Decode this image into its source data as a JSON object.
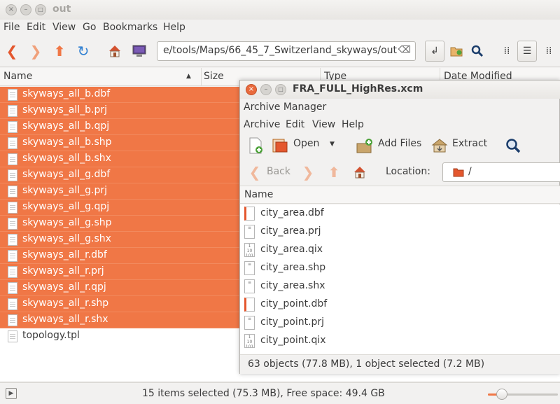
{
  "file_manager": {
    "title": "out",
    "menu": [
      "File",
      "Edit",
      "View",
      "Go",
      "Bookmarks",
      "Help"
    ],
    "location": "e/tools/Maps/66_45_7_Switzerland_skyways/out",
    "columns": {
      "name": "Name",
      "size": "Size",
      "type": "Type",
      "date": "Date Modified"
    },
    "files": [
      "skyways_all_b.dbf",
      "skyways_all_b.prj",
      "skyways_all_b.qpj",
      "skyways_all_b.shp",
      "skyways_all_b.shx",
      "skyways_all_g.dbf",
      "skyways_all_g.prj",
      "skyways_all_g.qpj",
      "skyways_all_g.shp",
      "skyways_all_g.shx",
      "skyways_all_r.dbf",
      "skyways_all_r.prj",
      "skyways_all_r.qpj",
      "skyways_all_r.shp",
      "skyways_all_r.shx",
      "topology.tpl"
    ],
    "selected_count": 15,
    "status": "15 items selected (75.3 MB), Free space: 49.4 GB",
    "zoom_level": 0.2
  },
  "archive_manager": {
    "title": "FRA_FULL_HighRes.xcm",
    "subtitle": "Archive Manager",
    "menu": [
      "Archive",
      "Edit",
      "View",
      "Help"
    ],
    "toolbar": {
      "open": "Open",
      "add_files": "Add Files",
      "extract": "Extract"
    },
    "nav": {
      "back": "Back",
      "location_label": "Location:",
      "location_value": "/"
    },
    "column_name": "Name",
    "files": [
      {
        "name": "city_area.dbf",
        "icon": "dbf"
      },
      {
        "name": "city_area.prj",
        "icon": "text"
      },
      {
        "name": "city_area.qix",
        "icon": "binary"
      },
      {
        "name": "city_area.shp",
        "icon": "text"
      },
      {
        "name": "city_area.shx",
        "icon": "text"
      },
      {
        "name": "city_point.dbf",
        "icon": "dbf"
      },
      {
        "name": "city_point.prj",
        "icon": "text"
      },
      {
        "name": "city_point.qix",
        "icon": "binary"
      }
    ],
    "status": "63 objects (77.8 MB), 1 object selected (7.2 MB)"
  },
  "colors": {
    "accent": "#f07746",
    "back_arrow": "#e4572e",
    "home": "#d35230"
  }
}
